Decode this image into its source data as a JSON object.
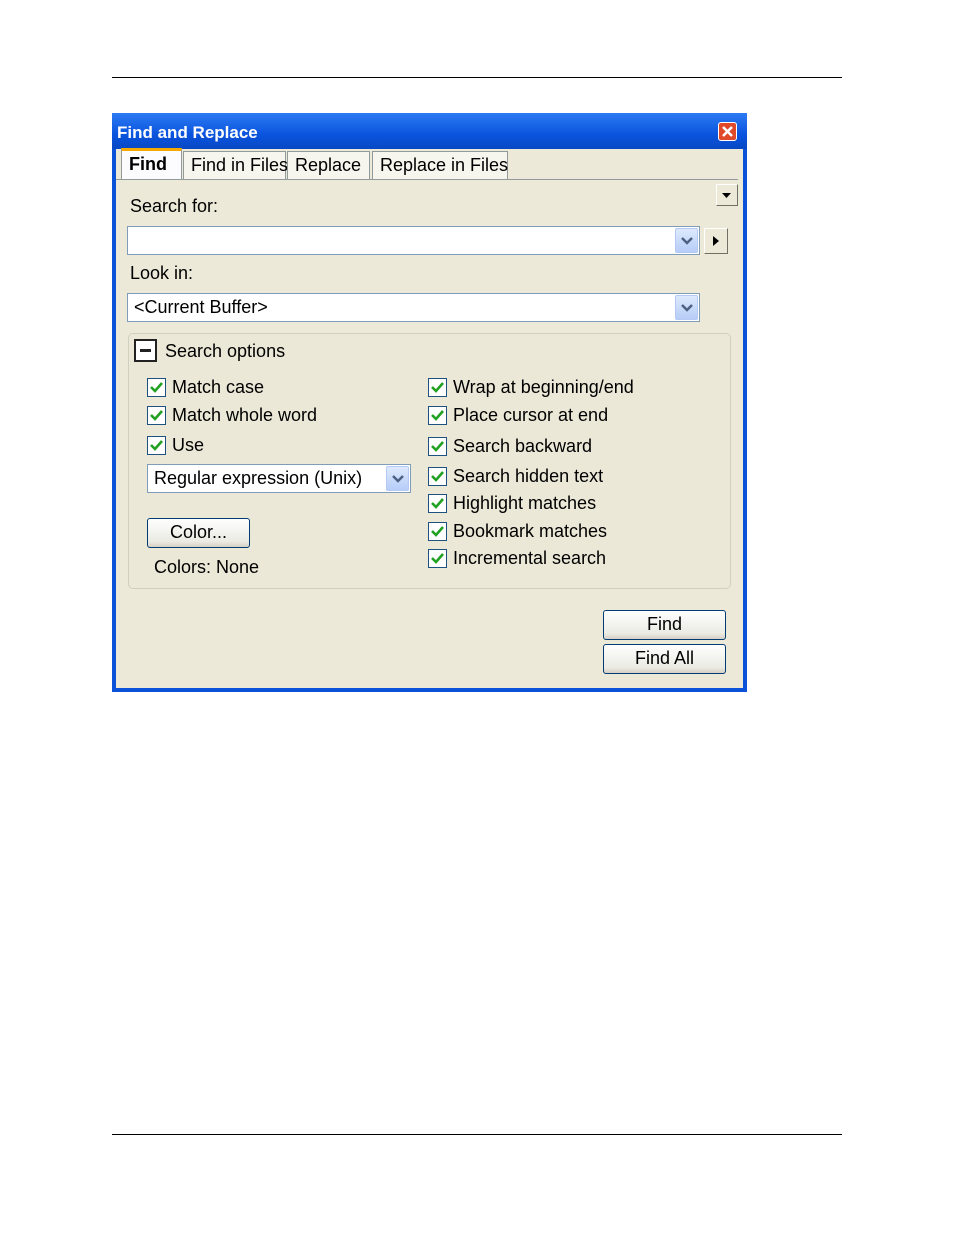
{
  "window": {
    "title": "Find and Replace"
  },
  "tabs": [
    {
      "label": "Find",
      "active": true
    },
    {
      "label": "Find in Files",
      "active": false
    },
    {
      "label": "Replace",
      "active": false
    },
    {
      "label": "Replace in Files",
      "active": false
    }
  ],
  "search_for": {
    "label": "Search for:",
    "value": ""
  },
  "look_in": {
    "label": "Look in:",
    "value": "<Current Buffer>"
  },
  "search_options": {
    "title": "Search options",
    "left_checks": [
      {
        "label": "Match case",
        "checked": true
      },
      {
        "label": "Match whole word",
        "checked": true
      },
      {
        "label": "Use",
        "checked": true
      }
    ],
    "regex_type": "Regular expression (Unix)",
    "color_button": "Color...",
    "colors_text": "Colors: None",
    "right_checks": [
      {
        "label": "Wrap at beginning/end",
        "checked": true
      },
      {
        "label": "Place cursor at end",
        "checked": true
      },
      {
        "label": "Search backward",
        "checked": true
      },
      {
        "label": "Search hidden text",
        "checked": true
      },
      {
        "label": "Highlight matches",
        "checked": true
      },
      {
        "label": "Bookmark matches",
        "checked": true
      },
      {
        "label": "Incremental search",
        "checked": true
      }
    ]
  },
  "buttons": {
    "find": "Find",
    "find_all": "Find All"
  },
  "colors": {
    "titlebar": "#0a54de",
    "dialog": "#ece9d8",
    "check": "#21a121"
  }
}
